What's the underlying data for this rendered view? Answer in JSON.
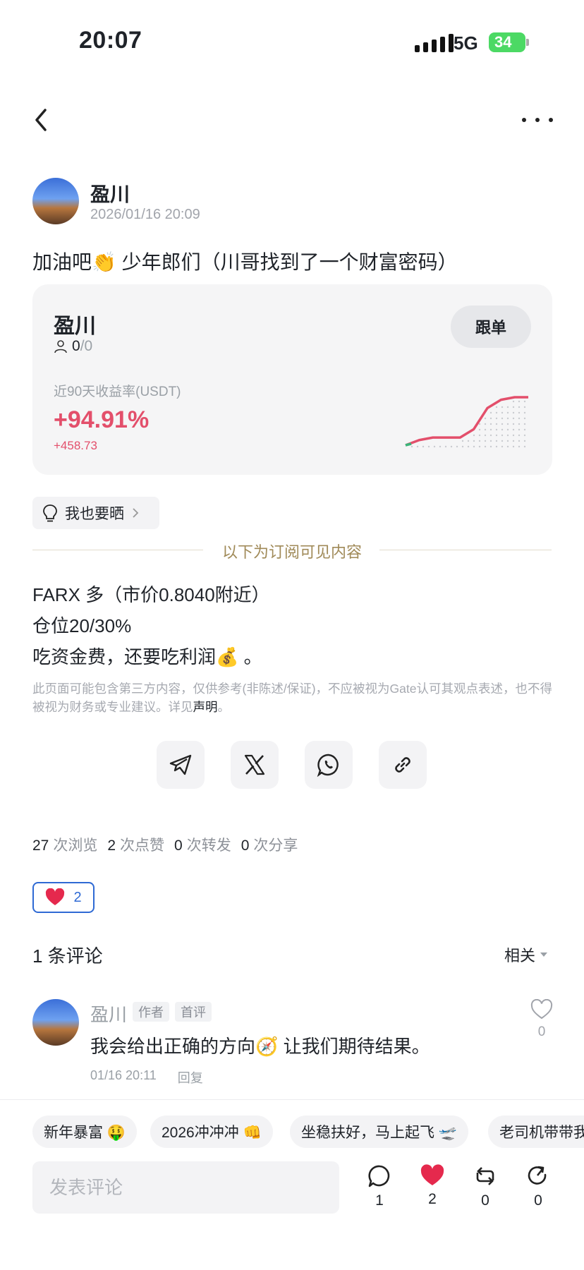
{
  "status_bar": {
    "time": "20:07",
    "network": "5G",
    "battery": "34"
  },
  "post": {
    "author": "盈川",
    "date": "2026/01/16 20:09",
    "title": "加油吧👏 少年郎们（川哥找到了一个财富密码）"
  },
  "trader_card": {
    "name": "盈川",
    "followers": "0",
    "followers_total": "/0",
    "follow_label": "跟单",
    "metric_label": "近90天收益率(USDT)",
    "metric_value": "+94.91%",
    "metric_sub": "+458.73",
    "accent_color": "#e34f6b"
  },
  "show_button": {
    "label": "我也要晒"
  },
  "divider": {
    "label": "以下为订阅可见内容"
  },
  "content": {
    "lines": [
      "FARX 多（市价0.8040附近）",
      "仓位20/30%",
      "吃资金费，还要吃利润💰 。"
    ],
    "disclaimer": "此页面可能包含第三方内容，仅供参考(非陈述/保证)，不应被视为Gate认可其观点表述，也不得被视为财务或专业建议。详见",
    "disclaimer_link": "声明",
    "disclaimer_end": "。"
  },
  "share": {
    "icons": [
      "telegram-icon",
      "x-icon",
      "whatsapp-icon",
      "link-icon"
    ]
  },
  "stats": {
    "views": "27",
    "views_label": "次浏览",
    "likes": "2",
    "likes_label": "次点赞",
    "reposts": "0",
    "reposts_label": "次转发",
    "shares": "0",
    "shares_label": "次分享"
  },
  "like_pill": {
    "count": "2",
    "color": "#2f6ad4"
  },
  "comments": {
    "title": "1 条评论",
    "sort": "相关",
    "items": [
      {
        "author": "盈川",
        "tag_author": "作者",
        "tag_first": "首评",
        "text": "我会给出正确的方向🧭 让我们期待结果。",
        "time": "01/16 20:11",
        "reply": "回复",
        "likes": "0"
      }
    ]
  },
  "bottom": {
    "chips": [
      "新年暴富 🤑",
      "2026冲冲冲 👊",
      "坐稳扶好，马上起飞 🛫",
      "老司机带带我"
    ],
    "input_placeholder": "发表评论",
    "comment_count": "1",
    "like_count": "2",
    "repost_count": "0",
    "share_count": "0"
  },
  "chart_data": {
    "type": "area",
    "values": [
      0,
      8,
      12,
      12,
      12,
      25,
      58,
      71,
      75,
      75
    ],
    "color": "#e34f6b"
  }
}
